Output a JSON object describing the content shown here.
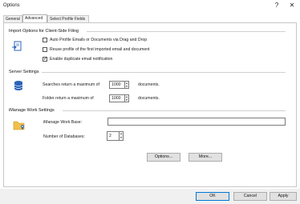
{
  "window": {
    "title": "Options",
    "help_glyph": "?",
    "close_glyph": "✕"
  },
  "tabs": [
    {
      "label": "General"
    },
    {
      "label": "Advanced"
    },
    {
      "label": "Select Profile Fields"
    }
  ],
  "import": {
    "heading": "Import Options for Client-Side Filing",
    "options": [
      {
        "label": "Auto Profile Emails or Documents via Drag and Drop",
        "checked": false
      },
      {
        "label": "Reuse profile of the first imported email and document",
        "checked": false
      },
      {
        "label": "Enable duplicate email notification",
        "checked": true
      }
    ]
  },
  "server": {
    "heading": "Server Settings",
    "searches_prefix": "Searches return a maximum of",
    "searches_value": "1000",
    "searches_suffix": "documents.",
    "folder_prefix": "Folder return a maximum of",
    "folder_value": "1000",
    "folder_suffix": "documents."
  },
  "worksite": {
    "heading": "iManage Work Settings",
    "base_label": "iManage Work Base:",
    "base_value": "",
    "databases_label": "Number of Databases:",
    "databases_value": "2"
  },
  "buttons": {
    "options": "Options...",
    "more": "More...",
    "ok": "OK",
    "cancel": "Cancel",
    "apply": "Apply"
  },
  "check_glyph": "✓",
  "spin_up": "▲",
  "spin_down": "▼",
  "colors": {
    "accent": "#0078d7",
    "icon_blue": "#2b63b8"
  }
}
